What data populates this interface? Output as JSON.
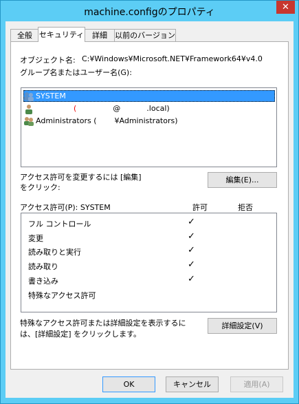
{
  "window": {
    "title": "machine.configのプロパティ",
    "close_glyph": "✕"
  },
  "tabs": [
    {
      "label": "全般"
    },
    {
      "label": "セキュリティ"
    },
    {
      "label": "詳細"
    },
    {
      "label": "以前のバージョン"
    }
  ],
  "object": {
    "label": "オブジェクト名:",
    "value": "C:¥Windows¥Microsoft.NET¥Framework64¥v4.0"
  },
  "group_label": "グループ名またはユーザー名(G):",
  "users": [
    {
      "name": "SYSTEM",
      "selected": true,
      "icon": "users-group-icon"
    },
    {
      "name_mid": "@",
      "name_end": ".local)",
      "icon": "user-icon"
    },
    {
      "name": "Administrators (",
      "name_end": "¥Administrators)",
      "icon": "users-group-icon"
    }
  ],
  "change_perm": {
    "text1": "アクセス許可を変更するには [編集]",
    "text2": "をクリック:",
    "edit_button": "編集(E)..."
  },
  "permissions": {
    "header": "アクセス許可(P): SYSTEM",
    "allow_header": "許可",
    "deny_header": "拒否",
    "check_glyph": "✓",
    "rows": [
      {
        "name": "フル コントロール",
        "allow": true
      },
      {
        "name": "変更",
        "allow": true
      },
      {
        "name": "読み取りと実行",
        "allow": true
      },
      {
        "name": "読み取り",
        "allow": true
      },
      {
        "name": "書き込み",
        "allow": true
      },
      {
        "name": "特殊なアクセス許可",
        "allow": false
      }
    ]
  },
  "advanced": {
    "text1": "特殊なアクセス許可または詳細設定を表示するに",
    "text2": "は、[詳細設定] をクリックします。",
    "button": "詳細設定(V)"
  },
  "footer": {
    "ok": "OK",
    "cancel": "キャンセル",
    "apply": "適用(A)"
  }
}
